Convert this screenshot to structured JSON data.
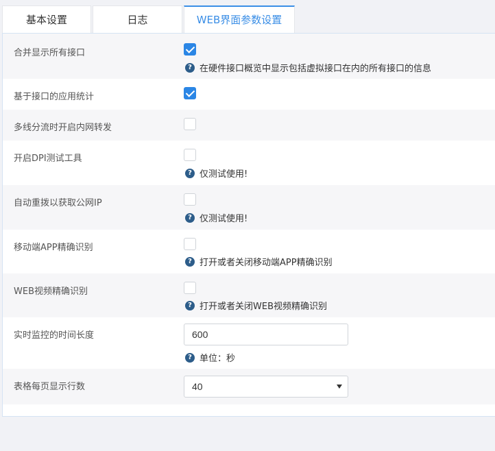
{
  "tabs": [
    {
      "label": "基本设置"
    },
    {
      "label": "日志"
    },
    {
      "label": "WEB界面参数设置",
      "active": true
    }
  ],
  "settings": [
    {
      "label": "合并显示所有接口",
      "checked": true,
      "help": "在硬件接口概览中显示包括虚拟接口在内的所有接口的信息"
    },
    {
      "label": "基于接口的应用统计",
      "checked": true
    },
    {
      "label": "多线分流时开启内网转发",
      "checked": false
    },
    {
      "label": "开启DPI测试工具",
      "checked": false,
      "help": "仅测试使用!"
    },
    {
      "label": "自动重拨以获取公网IP",
      "checked": false,
      "help": "仅测试使用!"
    },
    {
      "label": "移动端APP精确识别",
      "checked": false,
      "help": "打开或者关闭移动端APP精确识别"
    },
    {
      "label": "WEB视频精确识别",
      "checked": false,
      "help": "打开或者关闭WEB视频精确识别"
    },
    {
      "label": "实时监控的时间长度",
      "value": "600",
      "help": "单位：秒"
    },
    {
      "label": "表格每页显示行数",
      "selected": "40"
    }
  ],
  "colors": {
    "accent": "#2b86e5",
    "help_icon": "#2d5d8a"
  },
  "icons": {
    "help": "question-circle-icon",
    "check": "checkmark-icon",
    "dropdown": "caret-down-icon"
  }
}
